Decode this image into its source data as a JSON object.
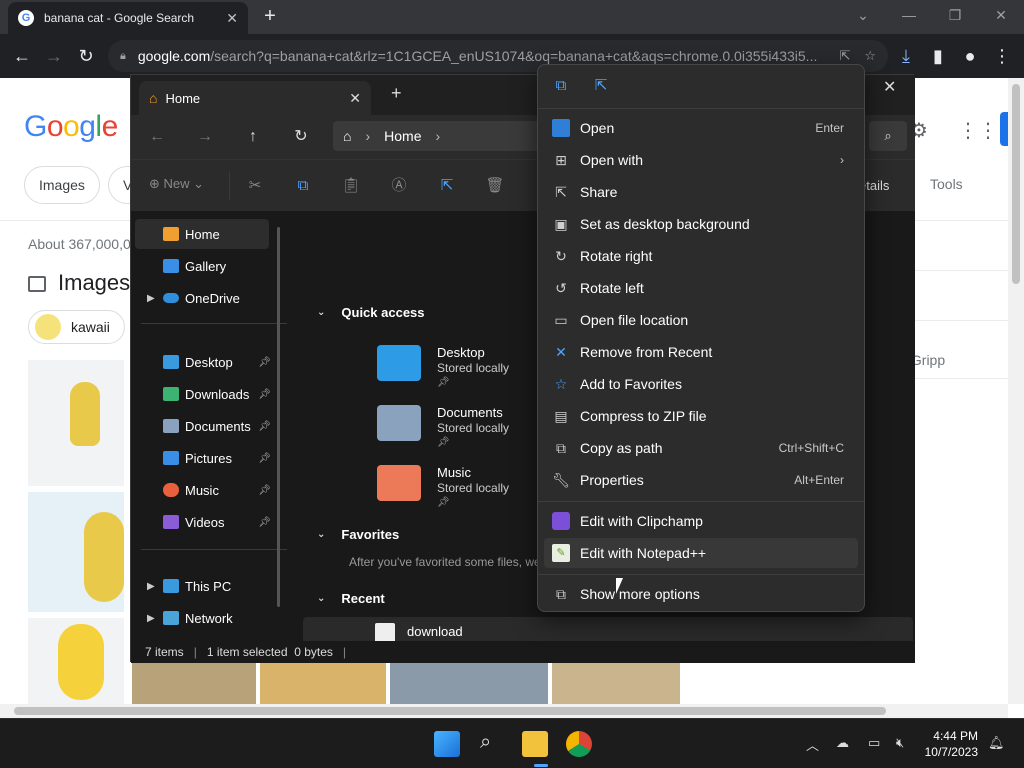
{
  "chrome": {
    "tab_title": "banana cat - Google Search",
    "url_host": "google.com",
    "url_path": "/search?q=banana+cat&rlz=1C1GCEA_enUS1074&oq=banana+cat&aqs=chrome.0.0i355i433i5..."
  },
  "google": {
    "logo": [
      "G",
      "o",
      "o",
      "g",
      "l",
      "e"
    ],
    "chip_images": "Images",
    "chip_v": "V",
    "about": "About 367,000,0",
    "images_heading": "Images",
    "kawaii_chip": "kawaii",
    "tools": "Tools",
    "gripp": "y Gripp"
  },
  "explorer": {
    "tab_title": "Home",
    "address": "Home",
    "new_label": "New",
    "details_label": "etails",
    "nav": [
      {
        "label": "Home"
      },
      {
        "label": "Gallery"
      },
      {
        "label": "OneDrive"
      },
      {
        "label": "Desktop"
      },
      {
        "label": "Downloads"
      },
      {
        "label": "Documents"
      },
      {
        "label": "Pictures"
      },
      {
        "label": "Music"
      },
      {
        "label": "Videos"
      },
      {
        "label": "This PC"
      },
      {
        "label": "Network"
      }
    ],
    "quick_access_title": "Quick access",
    "quick_access": [
      {
        "name": "Desktop",
        "status": "Stored locally"
      },
      {
        "name": "Documents",
        "status": "Stored locally"
      },
      {
        "name": "Music",
        "status": "Stored locally"
      }
    ],
    "favorites_title": "Favorites",
    "favorites_note": "After you've favorited some files, we",
    "recent_title": "Recent",
    "recent_item": "download",
    "status_items": "7 items",
    "status_selected": "1 item selected  0 bytes"
  },
  "context_menu": {
    "items": [
      {
        "label": "Open",
        "shortcut": "Enter"
      },
      {
        "label": "Open with",
        "shortcut": ""
      },
      {
        "label": "Share",
        "shortcut": ""
      },
      {
        "label": "Set as desktop background",
        "shortcut": ""
      },
      {
        "label": "Rotate right",
        "shortcut": ""
      },
      {
        "label": "Rotate left",
        "shortcut": ""
      },
      {
        "label": "Open file location",
        "shortcut": ""
      },
      {
        "label": "Remove from Recent",
        "shortcut": ""
      },
      {
        "label": "Add to Favorites",
        "shortcut": ""
      },
      {
        "label": "Compress to ZIP file",
        "shortcut": ""
      },
      {
        "label": "Copy as path",
        "shortcut": "Ctrl+Shift+C"
      },
      {
        "label": "Properties",
        "shortcut": "Alt+Enter"
      },
      {
        "label": "Edit with Clipchamp",
        "shortcut": ""
      },
      {
        "label": "Edit with Notepad++",
        "shortcut": ""
      },
      {
        "label": "Show more options",
        "shortcut": ""
      }
    ]
  },
  "taskbar": {
    "time": "4:44 PM",
    "date": "10/7/2023"
  },
  "colors": {
    "accent": "#4da3ff",
    "menu_bg": "#2c2c2c",
    "explorer_bg": "#191919"
  }
}
